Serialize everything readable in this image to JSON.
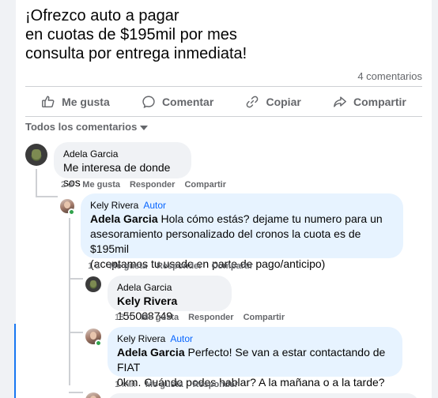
{
  "post": {
    "lines": [
      "¡Ofrezco auto a pagar",
      "en cuotas de $195mil por mes",
      "consulta por entrega inmediata!"
    ],
    "comment_count": "4 comentarios"
  },
  "actions": {
    "like": "Me gusta",
    "comment": "Comentar",
    "copy": "Copiar",
    "share": "Compartir"
  },
  "sort_label": "Todos los comentarios",
  "comments": [
    {
      "author": "Adela Garcia",
      "is_author": false,
      "mention": "",
      "text": "Me interesa de donde sos",
      "time": "2 d",
      "like": "Me gusta",
      "reply": "Responder",
      "share": "Compartir"
    },
    {
      "author": "Kely Rivera",
      "is_author": true,
      "author_tag": "Autor",
      "mention": "Adela Garcia",
      "text_lines": [
        " Hola cómo estás? dejame tu numero para un",
        "asesoramiento personalizado del cronos la cuota es de $195mil",
        "(aceptamos tu usado en parte de pago/anticipo)"
      ],
      "time": "1 d",
      "like": "Me gusta",
      "reply": "Responder",
      "share": "Compartir"
    },
    {
      "author": "Adela Garcia",
      "is_author": false,
      "mention": "Kely Rivera",
      "text": " 155068749",
      "time": "18 h",
      "like": "Me gusta",
      "reply": "Responder",
      "share": "Compartir"
    },
    {
      "author": "Kely Rivera",
      "is_author": true,
      "author_tag": "Autor",
      "mention": "Adela Garcia",
      "text_lines": [
        " Perfecto! Se van a estar contactando de FIAT",
        "0km. Cuándo podes hablar? A la mañana o a la tarde?"
      ],
      "time": "1 min",
      "like": "Me gusta",
      "reply": "Responder"
    }
  ],
  "colors": {
    "accent": "#0866ff",
    "bubble": "#f0f2f5",
    "author_bubble": "#e7f3ff",
    "muted": "#65676b",
    "online": "#31a24c"
  },
  "icons": [
    "like-icon",
    "comment-icon",
    "copy-link-icon",
    "share-icon",
    "chevron-down-icon"
  ]
}
